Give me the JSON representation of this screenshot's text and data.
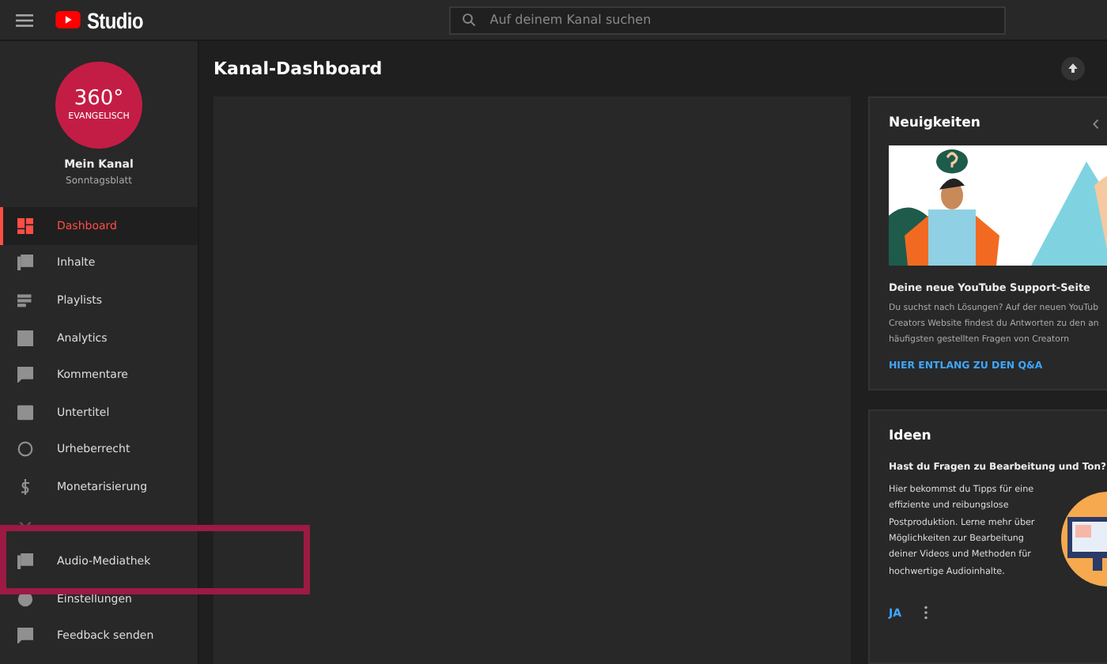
{
  "topbar": {
    "logo_text": "Studio",
    "search": {
      "placeholder": "Auf deinem Kanal suchen"
    }
  },
  "channel": {
    "avatar_line_1": "360°",
    "avatar_line_2": "EVANGELISCH",
    "name": "Mein Kanal",
    "subtitle": "Sonntagsblatt"
  },
  "sidebar": {
    "items": [
      {
        "label": "Dashboard",
        "selected": true
      },
      {
        "label": "Inhalte",
        "selected": false
      },
      {
        "label": "Playlists",
        "selected": false
      },
      {
        "label": "Analytics",
        "selected": false
      },
      {
        "label": "Kommentare",
        "selected": false
      },
      {
        "label": "Untertitel",
        "selected": false
      },
      {
        "label": "Urheberrecht",
        "selected": false
      },
      {
        "label": "Monetarisierung",
        "selected": false
      },
      {
        "kind": "icon_only",
        "selected": false
      },
      {
        "label": "Audio-Mediathek",
        "selected": false
      },
      {
        "label": "Einstellungen",
        "selected": false
      },
      {
        "label": "Feedback senden",
        "selected": false
      }
    ]
  },
  "page": {
    "title": "Kanal-Dashboard"
  },
  "news_card": {
    "title": "Neuigkeiten",
    "headline": "Deine neue YouTube Support-Seite",
    "body": "Du suchst nach Lösungen? Auf der neuen YouTub\nCreators Website findest du Antworten zu den an\nhäufigsten gestellten Fragen von Creatorn",
    "link": "HIER ENTLANG ZU DEN Q&A"
  },
  "ideas_card": {
    "title": "Ideen",
    "headline": "Hast du Fragen zu Bearbeitung und Ton?",
    "body": "Hier bekommst du Tipps für eine\neffiziente und reibungslose\nPostproduktion. Lerne mehr über\nMöglichkeiten zur Bearbeitung\ndeiner Videos und Methoden für\nhochwertige Audioinhalte.",
    "link": "JA"
  }
}
